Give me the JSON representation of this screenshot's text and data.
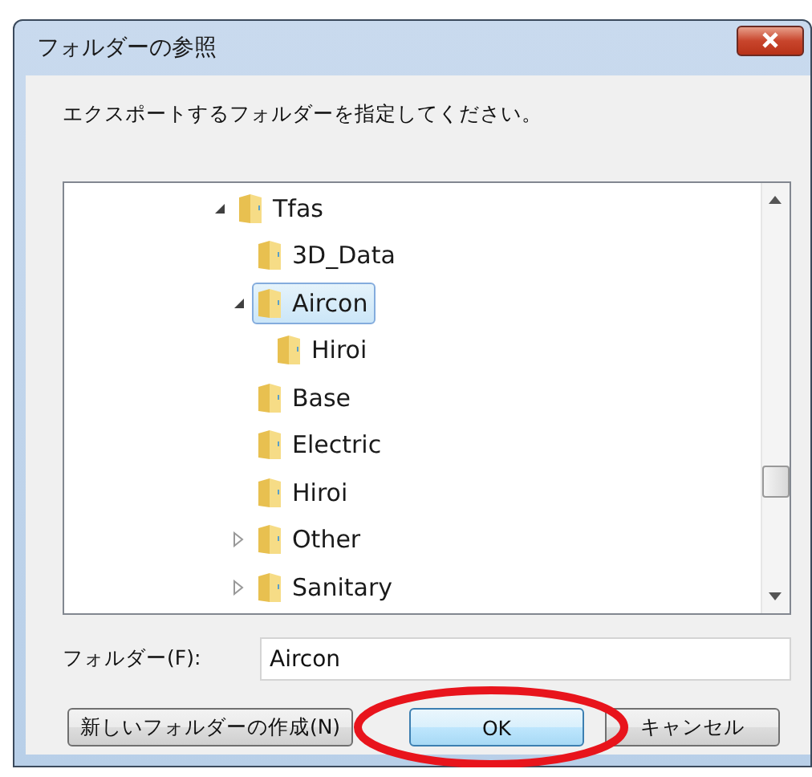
{
  "window": {
    "title": "フォルダーの参照"
  },
  "prompt": "エクスポートするフォルダーを指定してください。",
  "tree": [
    {
      "label": "Tfas",
      "expanded": true,
      "selected": false,
      "children": [
        {
          "label": "3D_Data",
          "selected": false
        },
        {
          "label": "Aircon",
          "expanded": true,
          "selected": true,
          "children": [
            {
              "label": "Hiroi",
              "selected": false
            }
          ]
        },
        {
          "label": "Base",
          "selected": false
        },
        {
          "label": "Electric",
          "selected": false
        },
        {
          "label": "Hiroi",
          "selected": false
        },
        {
          "label": "Other",
          "expanded": false,
          "selected": false
        },
        {
          "label": "Sanitary",
          "expanded": false,
          "selected": false
        }
      ]
    }
  ],
  "folder_field": {
    "label": "フォルダー(F):",
    "value": "Aircon"
  },
  "buttons": [
    {
      "label": "新しいフォルダーの作成(N)",
      "kind": "new"
    },
    {
      "label": "OK",
      "kind": "ok",
      "default": true
    },
    {
      "label": "キャンセル",
      "kind": "cancel",
      "default": false
    }
  ]
}
